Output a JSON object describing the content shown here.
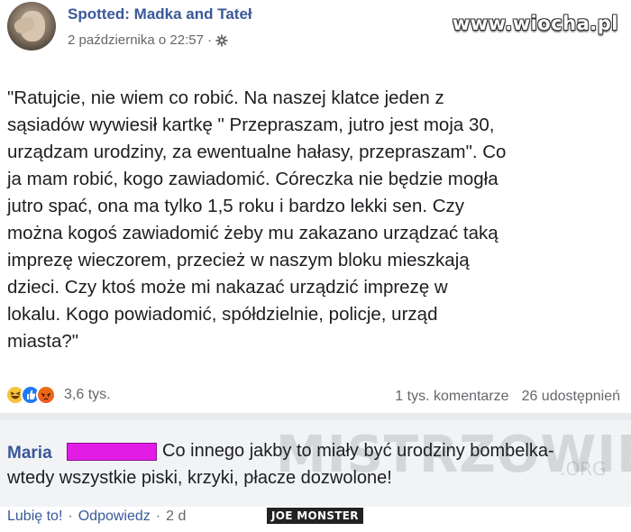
{
  "post": {
    "page_name": "Spotted: Madka and Tateł",
    "timestamp": "2 października o 22:57",
    "meta_separator": "·",
    "privacy_icon": "gear-icon",
    "text_lines": [
      "\"Ratujcie, nie wiem co robić. Na naszej klatce jeden z",
      "sąsiadów wywiesił kartkę \" Przepraszam, jutro jest moja 30,",
      "urządzam urodziny, za ewentualne hałasy, przepraszam\". Co",
      "ja mam robić, kogo zawiadomić. Córeczka nie będzie mogła",
      "jutro spać, ona ma tylko 1,5 roku i bardzo lekki sen. Czy",
      "można kogoś zawiadomić żeby mu zakazano urządzać taką",
      "imprezę wieczorem, przecież w naszym bloku mieszkają",
      "dzieci. Czy ktoś może mi nakazać urządzić imprezę w",
      "lokalu. Kogo powiadomić, spółdzielnie, policje, urząd",
      "miasta?\""
    ],
    "reactions": [
      "haha",
      "like",
      "angry"
    ],
    "reaction_count": "3,6 tys.",
    "comments_count": "1 tys. komentarze",
    "shares_count": "26 udostępnień"
  },
  "watermark": "www.wiocha.pl",
  "comment": {
    "author": "Maria",
    "text_line1": "Co innego jakby to miały być urodziny bombelka-",
    "text_line2": "wtedy wszystkie piski, krzyki, płacze dozwolone!",
    "like_label": "Lubię to!",
    "reply_label": "Odpowiedz",
    "age": "2 d",
    "sep": "·"
  },
  "overlay_watermark": {
    "main": "MISTRZOWIE",
    "suffix": ".ORG"
  },
  "badge": "JOE MONSTER",
  "colors": {
    "link_blue": "#385898",
    "page_blue": "#3b5998",
    "redact_magenta": "#e21ce5",
    "muted_gray": "#65676b"
  }
}
